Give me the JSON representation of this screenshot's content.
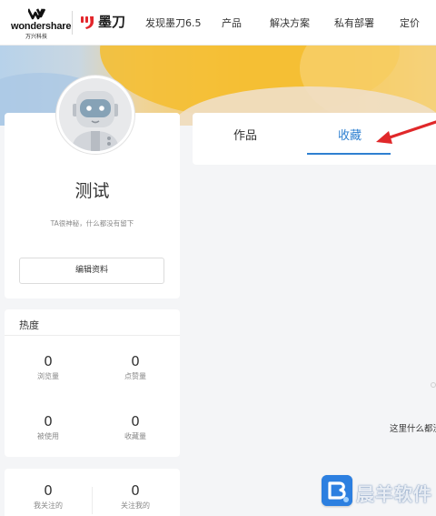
{
  "nav": {
    "brand_wordmark": "wondershare",
    "brand_sub": "万兴科技",
    "product_name": "墨刀",
    "items": [
      {
        "label": "发现墨刀6.5"
      },
      {
        "label": "产品"
      },
      {
        "label": "解决方案"
      },
      {
        "label": "私有部署"
      },
      {
        "label": "定价"
      }
    ]
  },
  "profile": {
    "username": "测试",
    "bio": "TA很神秘，什么都没有留下",
    "edit_label": "编辑资料"
  },
  "heat": {
    "title": "热度",
    "stats": [
      {
        "value": "0",
        "label": "浏览量"
      },
      {
        "value": "0",
        "label": "点赞量"
      },
      {
        "value": "0",
        "label": "被使用"
      },
      {
        "value": "0",
        "label": "收藏量"
      }
    ]
  },
  "follow": {
    "stats": [
      {
        "value": "0",
        "label": "我关注的"
      },
      {
        "value": "0",
        "label": "关注我的"
      }
    ]
  },
  "tabs": [
    {
      "label": "作品",
      "active": false
    },
    {
      "label": "收藏",
      "active": true
    }
  ],
  "empty_text": "这里什么都没",
  "watermark": {
    "text": "晨羊软件"
  },
  "colors": {
    "accent": "#2f80d1",
    "arrow": "#e0282a",
    "brand_red": "#e3262b"
  }
}
